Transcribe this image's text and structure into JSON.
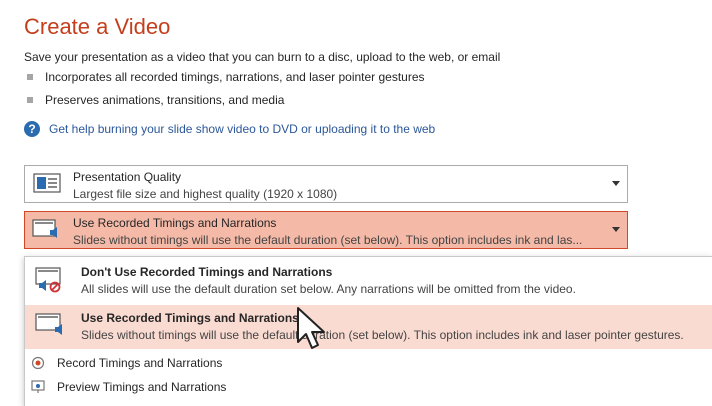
{
  "header": {
    "title": "Create a Video",
    "subtitle": "Save your presentation as a video that you can burn to a disc, upload to the web, or email",
    "bullets": [
      "Incorporates all recorded timings, narrations, and laser pointer gestures",
      "Preserves animations, transitions, and media"
    ],
    "help_link": "Get help burning your slide show video to DVD or uploading it to the web"
  },
  "quality_dropdown": {
    "label": "Presentation Quality",
    "description": "Largest file size and highest quality (1920 x 1080)"
  },
  "timings_dropdown": {
    "label": "Use Recorded Timings and Narrations",
    "description": "Slides without timings will use the default duration (set below). This option includes ink and las..."
  },
  "timings_menu": {
    "options": [
      {
        "label": "Don't Use Recorded Timings and Narrations",
        "description": "All slides will use the default duration set below. Any narrations will be omitted from the video."
      },
      {
        "label": "Use Recorded Timings and Narrations",
        "description": "Slides without timings will use the default duration (set below). This option includes ink and laser pointer gestures."
      }
    ],
    "actions": [
      "Record Timings and Narrations",
      "Preview Timings and Narrations"
    ]
  },
  "colors": {
    "title": "#c43e1c",
    "selected_fill": "#f4b9a7",
    "selected_border": "#d24726",
    "menu_highlight": "#fadbd2",
    "link": "#2b579a"
  }
}
